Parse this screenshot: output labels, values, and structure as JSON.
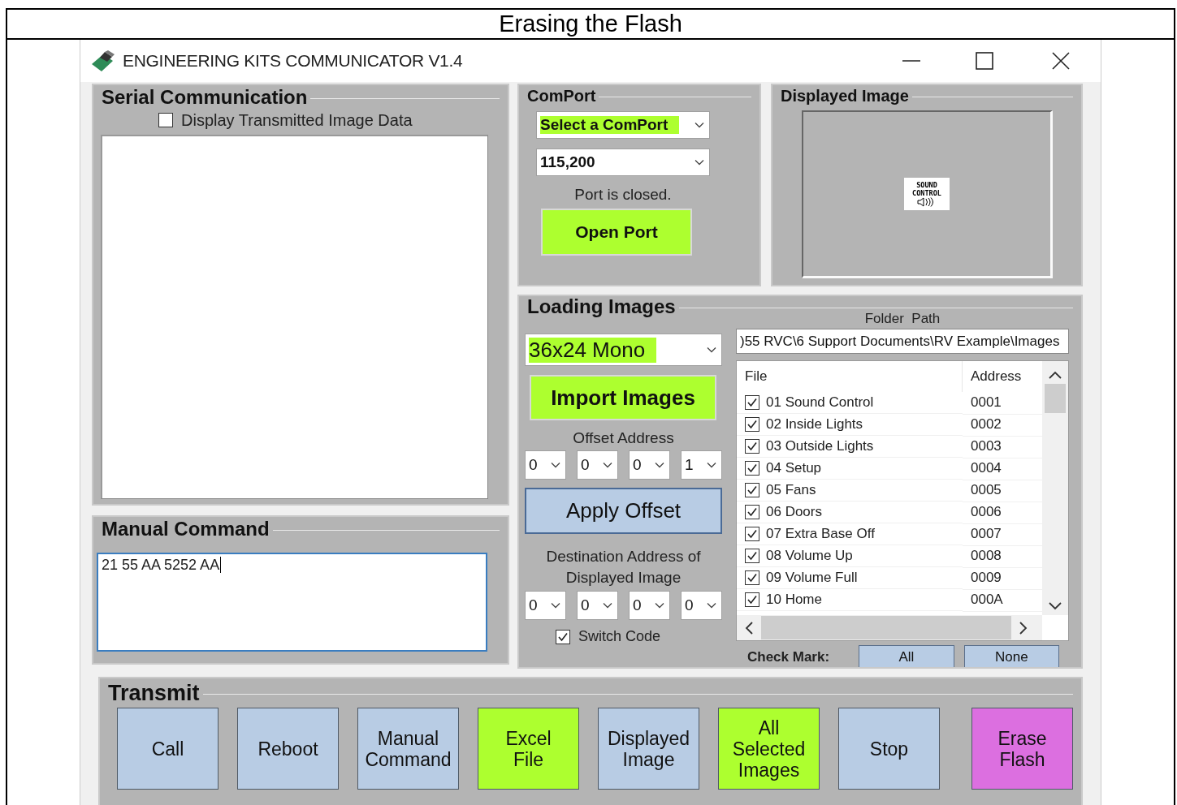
{
  "frame_title": "Erasing the Flash",
  "window": {
    "title": "ENGINEERING KITS COMMUNICATOR V1.4"
  },
  "serial": {
    "title": "Serial Communication",
    "display_checkbox": {
      "label": "Display Transmitted Image Data",
      "checked": false
    }
  },
  "manual_command": {
    "title": "Manual Command",
    "value": "21 55 AA 5252 AA"
  },
  "comport": {
    "title": "ComPort",
    "port_select": "Select a ComPort",
    "baud_select": "115,200",
    "status": "Port is closed.",
    "open_button": "Open Port"
  },
  "displayed_image": {
    "title": "Displayed Image",
    "preview_lines": [
      "SOUND",
      "CONTROL"
    ]
  },
  "loading_images": {
    "title": "Loading Images",
    "format_select": "36x24 Mono",
    "import_button": "Import Images",
    "offset_label": "Offset Address",
    "offset_digits": [
      "0",
      "0",
      "0",
      "1"
    ],
    "apply_button": "Apply Offset",
    "destination_label": "Destination Address of Displayed Image",
    "destination_digits": [
      "0",
      "0",
      "0",
      "0"
    ],
    "switch_code": {
      "label": "Switch Code",
      "checked": true
    },
    "folder_label": "Folder  Path",
    "folder_path": ")55 RVC\\6 Support Documents\\RV Example\\Images",
    "file_table": {
      "columns": [
        "File",
        "Address"
      ],
      "rows": [
        {
          "file": "01 Sound Control",
          "address": "0001",
          "checked": true
        },
        {
          "file": "02 Inside Lights",
          "address": "0002",
          "checked": true
        },
        {
          "file": "03 Outside Lights",
          "address": "0003",
          "checked": true
        },
        {
          "file": "04 Setup",
          "address": "0004",
          "checked": true
        },
        {
          "file": "05 Fans",
          "address": "0005",
          "checked": true
        },
        {
          "file": "06 Doors",
          "address": "0006",
          "checked": true
        },
        {
          "file": "07 Extra Base Off",
          "address": "0007",
          "checked": true
        },
        {
          "file": "08 Volume Up",
          "address": "0008",
          "checked": true
        },
        {
          "file": "09 Volume Full",
          "address": "0009",
          "checked": true
        },
        {
          "file": "10 Home",
          "address": "000A",
          "checked": true
        }
      ]
    },
    "check_mark_label": "Check Mark:",
    "check_buttons": [
      "All",
      "None"
    ]
  },
  "transmit": {
    "title": "Transmit",
    "buttons": [
      {
        "label": "Call",
        "color": "#b8cce4"
      },
      {
        "label": "Reboot",
        "color": "#b8cce4"
      },
      {
        "label": "Manual Command",
        "color": "#b8cce4"
      },
      {
        "label": "Excel File",
        "color": "#adff2f"
      },
      {
        "label": "Displayed Image",
        "color": "#b8cce4"
      },
      {
        "label": "All Selected Images",
        "color": "#adff2f"
      },
      {
        "label": "Stop",
        "color": "#b8cce4"
      },
      {
        "label": "Erase Flash",
        "color": "#dc6fe0"
      }
    ]
  }
}
